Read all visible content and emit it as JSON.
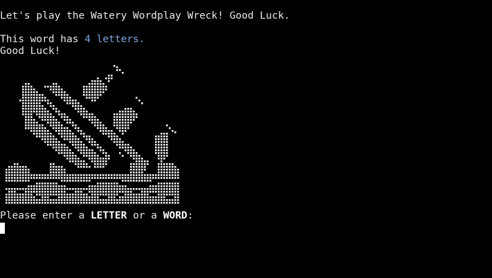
{
  "terminal": {
    "welcome": "Let's play the Watery Wordplay Wreck! Good Luck.",
    "letters_prefix": "This word has ",
    "letters_count": "4 letters.",
    "good_luck": "Good Luck!",
    "prompt": {
      "part1": "Please enter a ",
      "letter": "LETTER",
      "part2": " or a ",
      "word": "WORD",
      "part3": ":"
    }
  },
  "colors": {
    "background": "#000000",
    "text": "#e8e8e8",
    "accent": "#7fa7e0",
    "dot": "#f2f2f2"
  }
}
